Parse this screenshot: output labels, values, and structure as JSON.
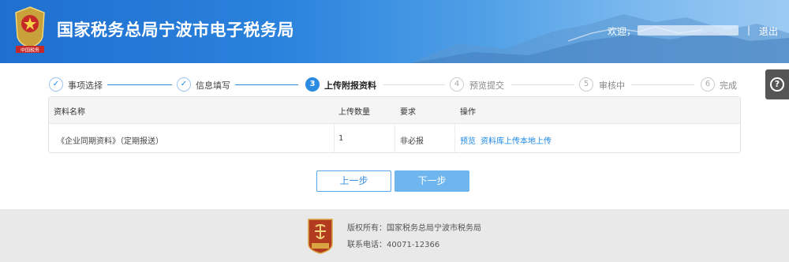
{
  "header": {
    "title": "国家税务总局宁波市电子税务局",
    "welcome": "欢迎，",
    "separator": "|",
    "logout": "退出"
  },
  "steps": [
    {
      "number": "✓",
      "label": "事项选择",
      "state": "done"
    },
    {
      "number": "✓",
      "label": "信息填写",
      "state": "done"
    },
    {
      "number": "3",
      "label": "上传附报资料",
      "state": "active"
    },
    {
      "number": "4",
      "label": "预览提交",
      "state": "pending"
    },
    {
      "number": "5",
      "label": "审核中",
      "state": "pending"
    },
    {
      "number": "6",
      "label": "完成",
      "state": "pending"
    }
  ],
  "table": {
    "headers": [
      "资料名称",
      "上传数量",
      "要求",
      "操作"
    ],
    "rows": [
      {
        "name": "《企业同期资料》（定期报送）",
        "count": "1",
        "requirement": "非必报",
        "actions": [
          "预览",
          "资料库上传",
          "本地上传"
        ]
      }
    ]
  },
  "buttons": {
    "prev": "上一步",
    "next": "下一步"
  },
  "help": {
    "icon": "question-icon",
    "glyph": "?"
  },
  "footer": {
    "copyright": "版权所有：国家税务总局宁波市税务局",
    "phone": "联系电话：40071-12366"
  },
  "colors": {
    "brand_blue": "#2a8be0",
    "link_blue": "#1e88e5",
    "next_button": "#6fb6ee",
    "footer_bg": "#e9e9e9"
  }
}
